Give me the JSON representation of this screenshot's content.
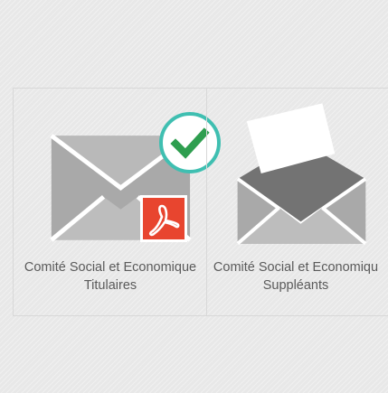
{
  "tiles": [
    {
      "label_line1": "Comité Social et Economique",
      "label_line2": "Titulaires",
      "icon": "closed-envelope-icon",
      "badges": [
        "checkmark-icon",
        "pdf-icon"
      ],
      "selected": true
    },
    {
      "label_line1": "Comité Social et Economiqu",
      "label_line2": "Suppléants",
      "icon": "open-envelope-ballot-icon",
      "badges": [],
      "selected": false
    }
  ],
  "colors": {
    "envelope": "#a6a6a6",
    "envelope_dark": "#6e6e6e",
    "check_ring": "#3fbfb1",
    "check_mark": "#2e9e4f",
    "pdf_red": "#e8452f",
    "label_text": "#5a5a5a"
  }
}
